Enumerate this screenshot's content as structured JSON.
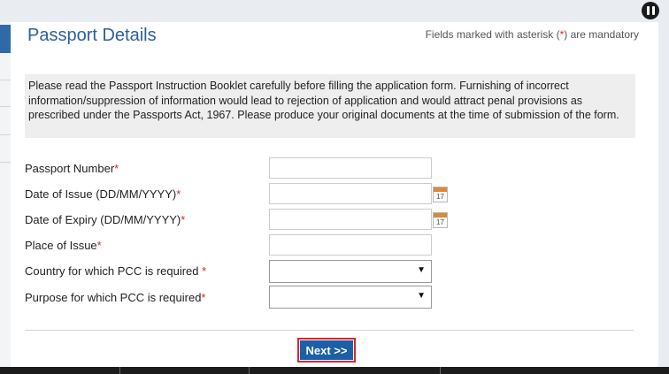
{
  "header": {
    "title": "Passport Details",
    "mandatory_prefix": "Fields marked with asterisk (",
    "mandatory_star": "*",
    "mandatory_suffix": ") are mandatory"
  },
  "notice": "Please read the Passport Instruction Booklet carefully before filling the application form. Furnishing of incorrect information/suppression of information would lead to rejection of application and would attract penal provisions as prescribed under the Passports Act, 1967. Please produce your original documents at the time of submission of the form.",
  "form": {
    "required_mark": "*",
    "passport_number": {
      "label": "Passport Number",
      "value": ""
    },
    "date_of_issue": {
      "label": "Date of Issue (DD/MM/YYYY)",
      "value": ""
    },
    "date_of_expiry": {
      "label": "Date of Expiry (DD/MM/YYYY)",
      "value": ""
    },
    "place_of_issue": {
      "label": "Place of Issue",
      "value": ""
    },
    "country": {
      "label": "Country for which PCC is required ",
      "selected": ""
    },
    "purpose": {
      "label": "Purpose for which PCC is required",
      "selected": ""
    },
    "calendar_day": "17"
  },
  "actions": {
    "next_label": "Next >>"
  },
  "icons": {
    "pause": "pause-icon",
    "calendar": "calendar-icon",
    "dropdown": "dropdown-arrow-icon"
  },
  "colors": {
    "accent": "#1d5fa6",
    "title": "#2d5f9c",
    "required": "#d9262b",
    "highlight_border": "#d7242e"
  }
}
